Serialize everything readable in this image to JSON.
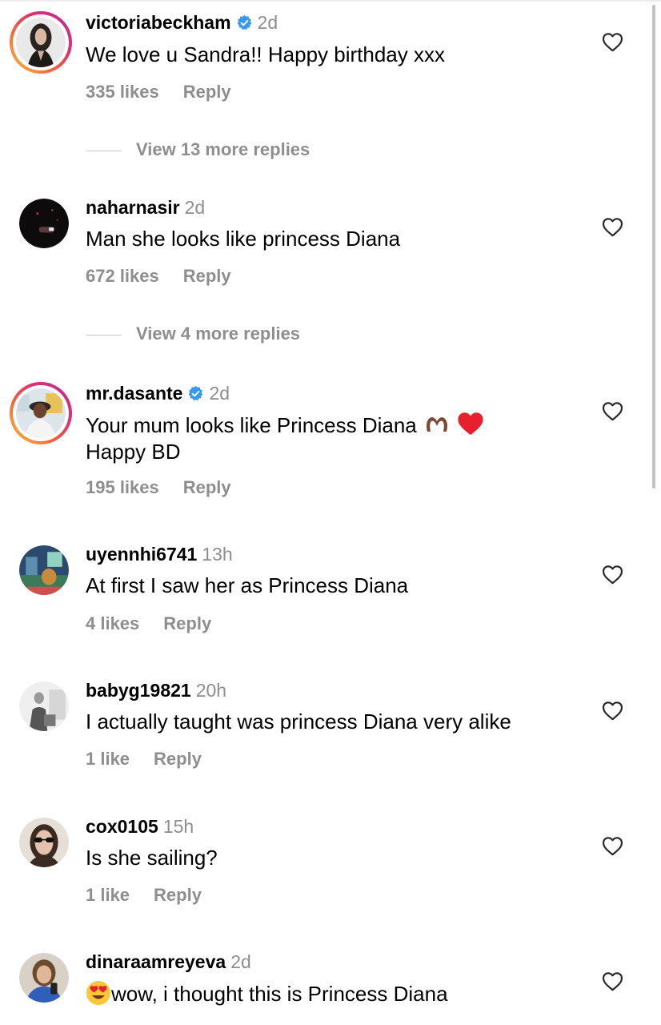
{
  "comments": [
    {
      "username": "victoriabeckham",
      "verified": true,
      "time": "2d",
      "text": "We love u Sandra!! Happy birthday xxx",
      "likes": "335 likes",
      "reply": "Reply",
      "view_more": "View 13 more replies",
      "avatar_icon": "woman-photo-avatar"
    },
    {
      "username": "naharnasir",
      "verified": false,
      "time": "2d",
      "text": "Man she looks like princess Diana",
      "likes": "672 likes",
      "reply": "Reply",
      "view_more": "View 4 more replies",
      "avatar_icon": "dark-photo-avatar"
    },
    {
      "username": "mr.dasante",
      "verified": true,
      "time": "2d",
      "text_line1": "Your mum looks like Princess Diana",
      "text_line2": "Happy BD",
      "likes": "195 likes",
      "reply": "Reply",
      "avatar_icon": "man-photo-avatar",
      "emojis": [
        "heart-hands-emoji",
        "red-heart-emoji"
      ]
    },
    {
      "username": "uyennhi6741",
      "verified": false,
      "time": "13h",
      "text": "At first I saw her as Princess Diana",
      "likes": "4 likes",
      "reply": "Reply",
      "avatar_icon": "game-scene-avatar"
    },
    {
      "username": "babyg19821",
      "verified": false,
      "time": "20h",
      "text": "I actually taught was princess Diana very alike",
      "likes": "1 like",
      "reply": "Reply",
      "avatar_icon": "bw-photo-avatar"
    },
    {
      "username": "cox0105",
      "verified": false,
      "time": "15h",
      "text": "Is she sailing?",
      "likes": "1 like",
      "reply": "Reply",
      "avatar_icon": "sunglasses-woman-avatar"
    },
    {
      "username": "dinaraamreyeva",
      "verified": false,
      "time": "2d",
      "text": "wow, i thought this is Princess Diana",
      "avatar_icon": "selfie-woman-avatar",
      "emojis": [
        "heart-eyes-emoji"
      ]
    }
  ],
  "colors": {
    "muted": "#8e8e8e",
    "verified_blue": "#3897f0",
    "story_ring_start": "#f9c23c",
    "story_ring_end": "#b52d9a"
  },
  "icons": {
    "like": "heart-outline-icon",
    "verified": "verified-badge-icon"
  }
}
